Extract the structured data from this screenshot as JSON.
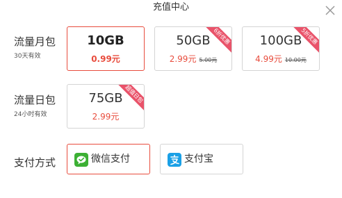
{
  "header": {
    "title": "充值中心"
  },
  "monthly": {
    "label": "流量月包",
    "sub": "30天有效",
    "cards": [
      {
        "size": "10GB",
        "price": "0.99元",
        "original": "",
        "ribbon": ""
      },
      {
        "size": "50GB",
        "price": "2.99元",
        "original": "5.00元",
        "ribbon": "6折优惠"
      },
      {
        "size": "100GB",
        "price": "4.99元",
        "original": "10.00元",
        "ribbon": "5折优惠"
      }
    ]
  },
  "daily": {
    "label": "流量日包",
    "sub": "24小时有效",
    "cards": [
      {
        "size": "75GB",
        "price": "2.99元",
        "ribbon": "超值日包"
      }
    ]
  },
  "payment": {
    "label": "支付方式",
    "options": [
      {
        "label": "微信支付",
        "icon": "wechat-pay-icon"
      },
      {
        "label": "支付宝",
        "icon": "alipay-icon"
      }
    ]
  },
  "colors": {
    "accent": "#e84c3d",
    "ribbon": "#e9536a",
    "wechat": "#3cb034",
    "alipay": "#1aa0e6"
  }
}
